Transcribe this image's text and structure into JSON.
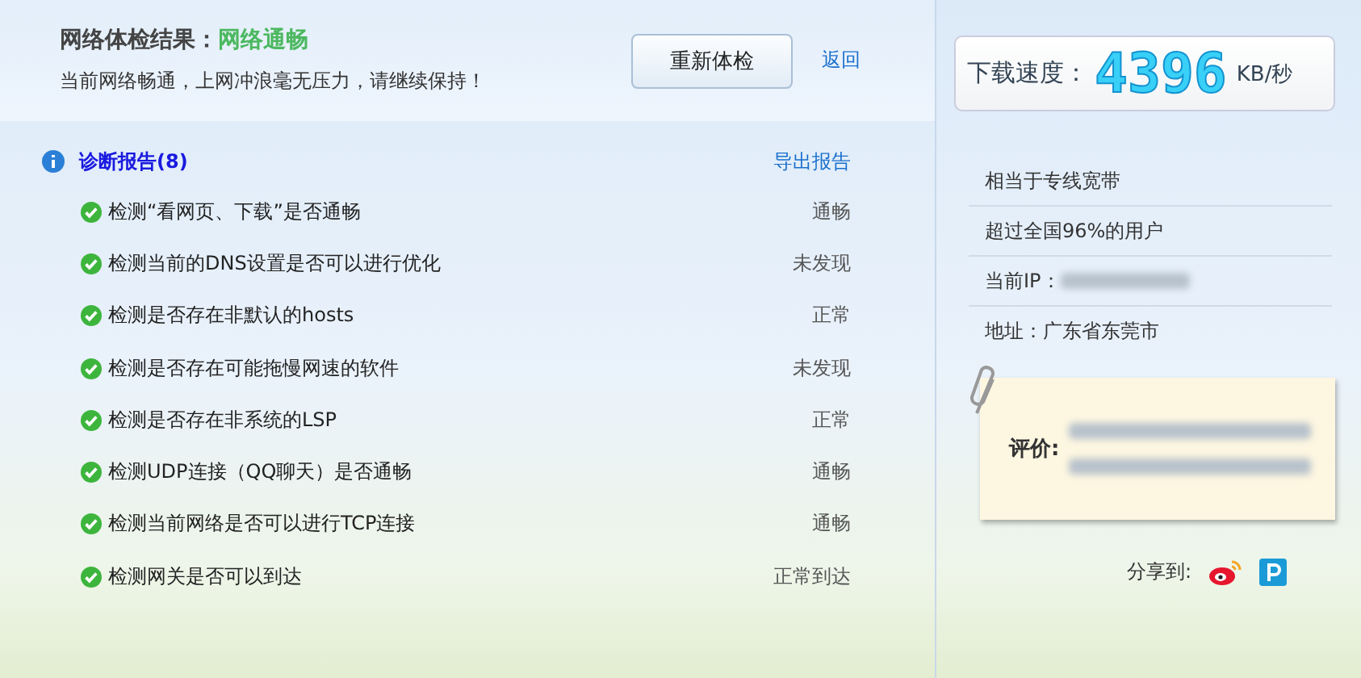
{
  "header": {
    "title": "网络体检结果：",
    "status": "网络通畅",
    "message": "当前网络畅通，上网冲浪毫无压力，请继续保持！",
    "recheck_button": "重新体检",
    "back_link": "返回"
  },
  "report": {
    "title": "诊断报告(8)",
    "export_link": "导出报告",
    "items": [
      {
        "label": "检测“看网页、下载”是否通畅",
        "result": "通畅",
        "passed": true
      },
      {
        "label": "检测当前的DNS设置是否可以进行优化",
        "result": "未发现",
        "passed": true
      },
      {
        "label": "检测是否存在非默认的hosts",
        "result": "正常",
        "passed": true
      },
      {
        "label": "检测是否存在可能拖慢网速的软件",
        "result": "未发现",
        "passed": true
      },
      {
        "label": "检测是否存在非系统的LSP",
        "result": "正常",
        "passed": true
      },
      {
        "label": "检测UDP连接（QQ聊天）是否通畅",
        "result": "通畅",
        "passed": true
      },
      {
        "label": "检测当前网络是否可以进行TCP连接",
        "result": "通畅",
        "passed": true
      },
      {
        "label": "检测网关是否可以到达",
        "result": "正常到达",
        "passed": true
      }
    ]
  },
  "speed": {
    "label": "下载速度：",
    "value": "4396",
    "unit": "KB/秒"
  },
  "info": [
    {
      "text": "相当于专线宽带",
      "redacted": false
    },
    {
      "text": "超过全国96%的用户",
      "redacted": false
    },
    {
      "text": "当前IP：",
      "redacted": true
    },
    {
      "text": "地址：广东省东莞市",
      "redacted": false
    }
  ],
  "note": {
    "label": "评价:"
  },
  "share": {
    "label": "分享到:"
  }
}
